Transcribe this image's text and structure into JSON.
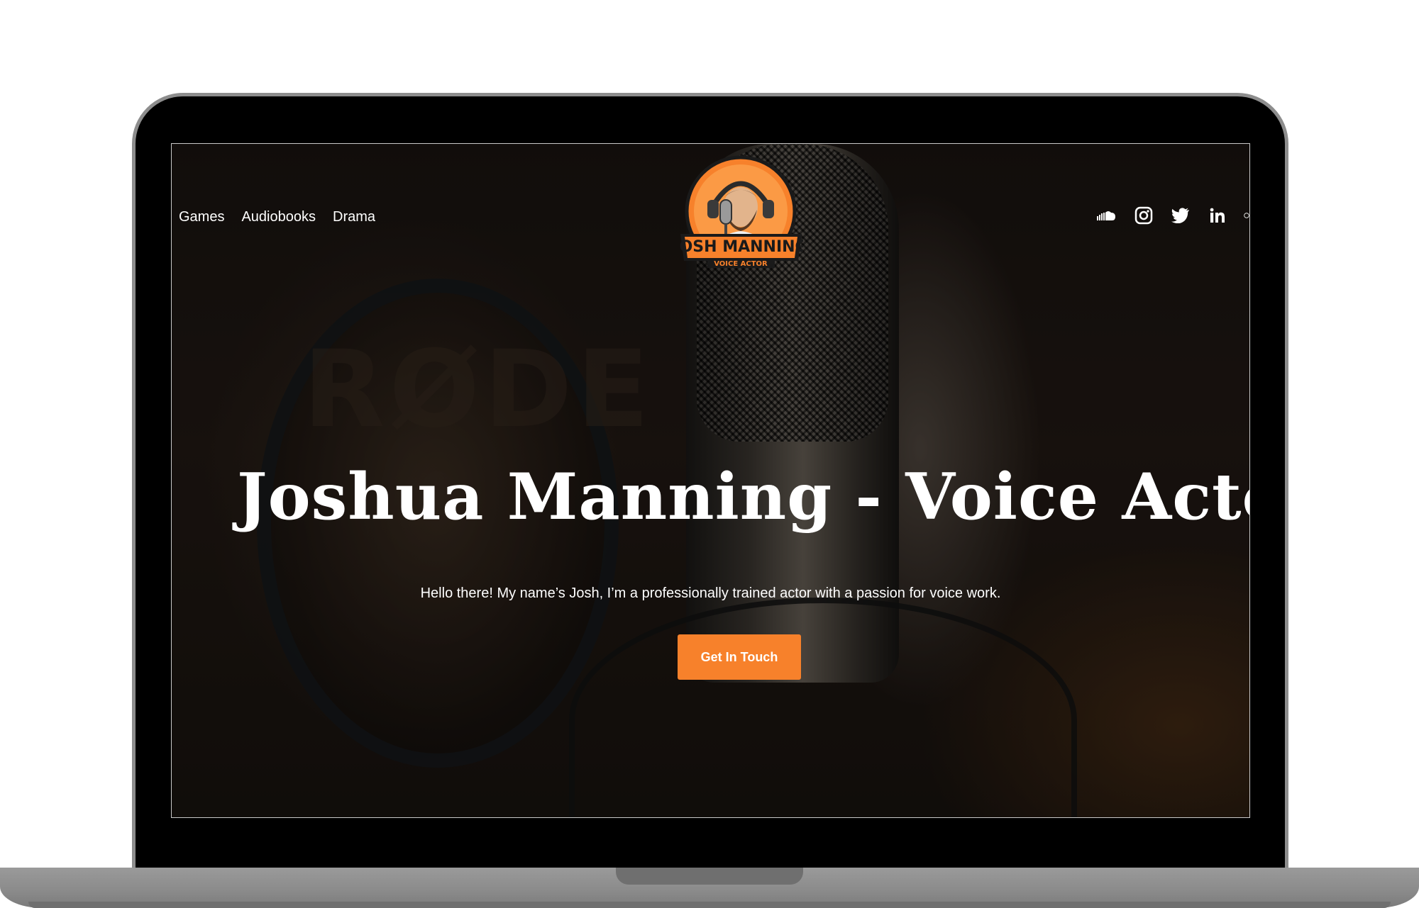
{
  "nav": {
    "items": [
      {
        "label": "Games"
      },
      {
        "label": "Audiobooks"
      },
      {
        "label": "Drama"
      }
    ]
  },
  "logo": {
    "line1": "JOSH MANNING",
    "line2": "VOICE ACTOR"
  },
  "social": {
    "icons": [
      "soundcloud-icon",
      "instagram-icon",
      "twitter-icon",
      "linkedin-icon"
    ]
  },
  "hero": {
    "title": "Joshua Manning - Voice Actor",
    "subtitle": "Hello there! My name’s Josh, I’m a professionally trained actor with a passion for voice work.",
    "cta_label": "Get In Touch"
  },
  "background": {
    "brand_text": "RØDE"
  },
  "colors": {
    "accent": "#f7812b",
    "text": "#ffffff",
    "frame": "#000000",
    "laptop_body": "#8d8d8d"
  }
}
